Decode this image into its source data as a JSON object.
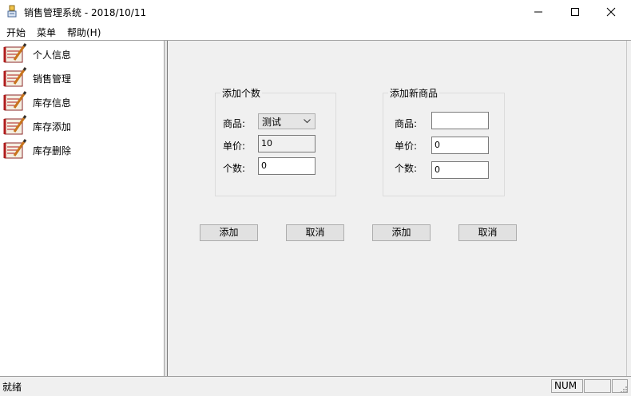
{
  "window": {
    "title": "销售管理系统 - 2018/10/11"
  },
  "menu": {
    "items": [
      "开始",
      "菜单",
      "帮助(H)"
    ]
  },
  "tree": {
    "items": [
      {
        "label": "个人信息",
        "icon": "notebook-pen-icon"
      },
      {
        "label": "销售管理",
        "icon": "notebook-pen-icon"
      },
      {
        "label": "库存信息",
        "icon": "notebook-pen-icon"
      },
      {
        "label": "库存添加",
        "icon": "notebook-pen-icon"
      },
      {
        "label": "库存删除",
        "icon": "notebook-pen-icon"
      }
    ]
  },
  "add_count": {
    "title": "添加个数",
    "product_label": "商品:",
    "product_value": "测试",
    "price_label": "单价:",
    "price_value": "10",
    "count_label": "个数:",
    "count_value": "0"
  },
  "add_new": {
    "title": "添加新商品",
    "product_label": "商品:",
    "product_value": "",
    "price_label": "单价:",
    "price_value": "0",
    "count_label": "个数:",
    "count_value": "0"
  },
  "buttons": {
    "add1": "添加",
    "cancel1": "取消",
    "add2": "添加",
    "cancel2": "取消"
  },
  "status": {
    "text": "就绪",
    "num": "NUM"
  },
  "colors": {
    "client_bg": "#f0f0f0",
    "button_bg": "#e1e1e1",
    "icon_red": "#b01c1c"
  }
}
